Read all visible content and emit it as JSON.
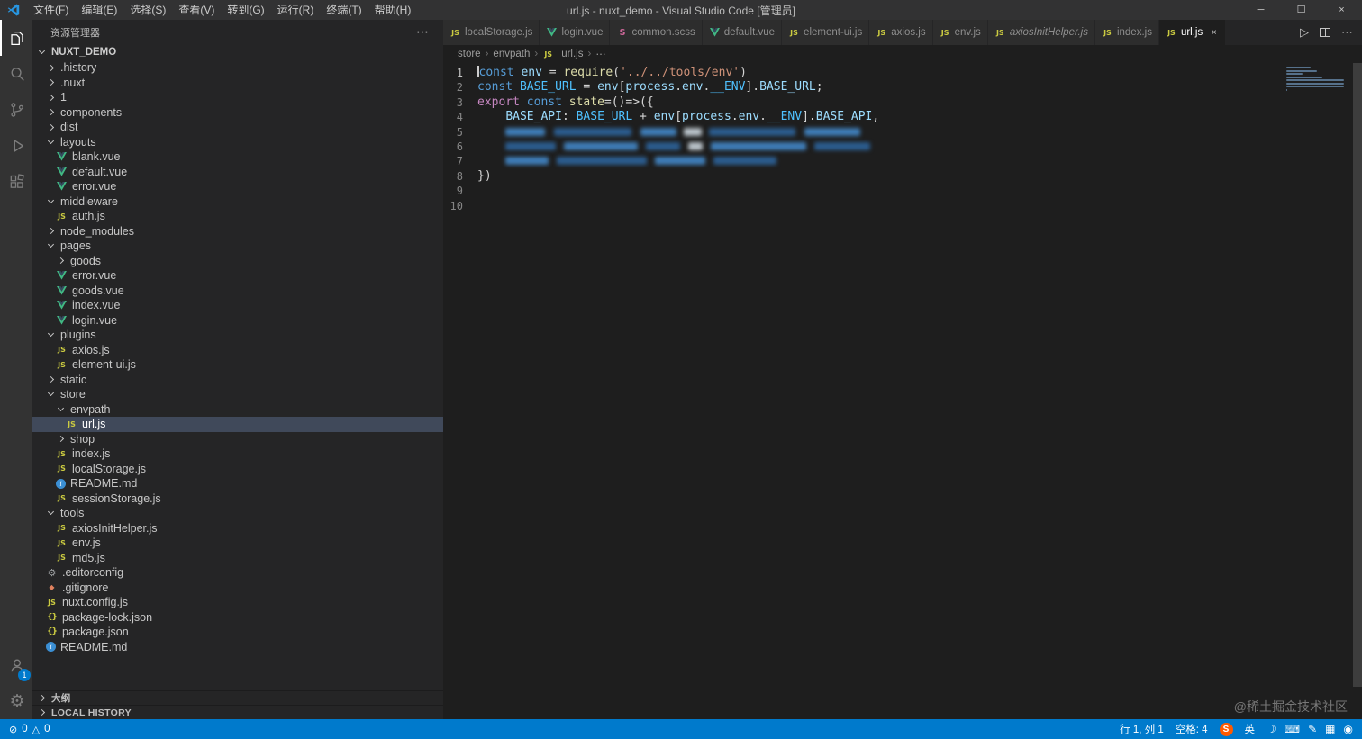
{
  "colors": {
    "accent": "#007acc",
    "statusbar_bg": "#007acc",
    "vue_green": "#41b883",
    "js_yellow": "#cbcb41",
    "scss_pink": "#cd6799",
    "selection_bg": "#40495a"
  },
  "titlebar": {
    "menus": [
      "文件(F)",
      "编辑(E)",
      "选择(S)",
      "查看(V)",
      "转到(G)",
      "运行(R)",
      "终端(T)",
      "帮助(H)"
    ],
    "title": "url.js - nuxt_demo - Visual Studio Code [管理员]",
    "window_controls": {
      "minimize": "─",
      "maximize": "☐",
      "close": "×"
    }
  },
  "activitybar": {
    "top": [
      {
        "name": "explorer",
        "active": true
      },
      {
        "name": "search"
      },
      {
        "name": "source-control"
      },
      {
        "name": "run-debug"
      },
      {
        "name": "extensions"
      }
    ],
    "bottom": [
      {
        "name": "account",
        "badge": "1"
      },
      {
        "name": "settings"
      }
    ]
  },
  "sidebar": {
    "header": "资源管理器",
    "more_actions": "⋯",
    "root": "NUXT_DEMO",
    "tree": [
      {
        "label": ".history",
        "level": 1,
        "kind": "folder",
        "state": "collapsed"
      },
      {
        "label": ".nuxt",
        "level": 1,
        "kind": "folder",
        "state": "collapsed"
      },
      {
        "label": "1",
        "level": 1,
        "kind": "folder",
        "state": "collapsed"
      },
      {
        "label": "components",
        "level": 1,
        "kind": "folder",
        "state": "collapsed"
      },
      {
        "label": "dist",
        "level": 1,
        "kind": "folder",
        "state": "collapsed"
      },
      {
        "label": "layouts",
        "level": 1,
        "kind": "folder",
        "state": "expanded"
      },
      {
        "label": "blank.vue",
        "level": 2,
        "kind": "file",
        "icon": "vue"
      },
      {
        "label": "default.vue",
        "level": 2,
        "kind": "file",
        "icon": "vue"
      },
      {
        "label": "error.vue",
        "level": 2,
        "kind": "file",
        "icon": "vue"
      },
      {
        "label": "middleware",
        "level": 1,
        "kind": "folder",
        "state": "expanded"
      },
      {
        "label": "auth.js",
        "level": 2,
        "kind": "file",
        "icon": "js"
      },
      {
        "label": "node_modules",
        "level": 1,
        "kind": "folder",
        "state": "collapsed"
      },
      {
        "label": "pages",
        "level": 1,
        "kind": "folder",
        "state": "expanded"
      },
      {
        "label": "goods",
        "level": 2,
        "kind": "folder",
        "state": "collapsed"
      },
      {
        "label": "error.vue",
        "level": 2,
        "kind": "file",
        "icon": "vue"
      },
      {
        "label": "goods.vue",
        "level": 2,
        "kind": "file",
        "icon": "vue"
      },
      {
        "label": "index.vue",
        "level": 2,
        "kind": "file",
        "icon": "vue"
      },
      {
        "label": "login.vue",
        "level": 2,
        "kind": "file",
        "icon": "vue"
      },
      {
        "label": "plugins",
        "level": 1,
        "kind": "folder",
        "state": "expanded"
      },
      {
        "label": "axios.js",
        "level": 2,
        "kind": "file",
        "icon": "js"
      },
      {
        "label": "element-ui.js",
        "level": 2,
        "kind": "file",
        "icon": "js"
      },
      {
        "label": "static",
        "level": 1,
        "kind": "folder",
        "state": "collapsed"
      },
      {
        "label": "store",
        "level": 1,
        "kind": "folder",
        "state": "expanded"
      },
      {
        "label": "envpath",
        "level": 2,
        "kind": "folder",
        "state": "expanded"
      },
      {
        "label": "url.js",
        "level": 3,
        "kind": "file",
        "icon": "js",
        "selected": true
      },
      {
        "label": "shop",
        "level": 2,
        "kind": "folder",
        "state": "collapsed"
      },
      {
        "label": "index.js",
        "level": 2,
        "kind": "file",
        "icon": "js"
      },
      {
        "label": "localStorage.js",
        "level": 2,
        "kind": "file",
        "icon": "js"
      },
      {
        "label": "README.md",
        "level": 2,
        "kind": "file",
        "icon": "info"
      },
      {
        "label": "sessionStorage.js",
        "level": 2,
        "kind": "file",
        "icon": "js"
      },
      {
        "label": "tools",
        "level": 1,
        "kind": "folder",
        "state": "expanded"
      },
      {
        "label": "axiosInitHelper.js",
        "level": 2,
        "kind": "file",
        "icon": "js"
      },
      {
        "label": "env.js",
        "level": 2,
        "kind": "file",
        "icon": "js"
      },
      {
        "label": "md5.js",
        "level": 2,
        "kind": "file",
        "icon": "js"
      },
      {
        "label": ".editorconfig",
        "level": 1,
        "kind": "file",
        "icon": "gear"
      },
      {
        "label": ".gitignore",
        "level": 1,
        "kind": "file",
        "icon": "git"
      },
      {
        "label": "nuxt.config.js",
        "level": 1,
        "kind": "file",
        "icon": "js"
      },
      {
        "label": "package-lock.json",
        "level": 1,
        "kind": "file",
        "icon": "braces"
      },
      {
        "label": "package.json",
        "level": 1,
        "kind": "file",
        "icon": "braces"
      },
      {
        "label": "README.md",
        "level": 1,
        "kind": "file",
        "icon": "info"
      }
    ],
    "bottom_sections": [
      "大纲",
      "LOCAL HISTORY"
    ]
  },
  "editor": {
    "tabs": [
      {
        "label": "localStorage.js",
        "icon": "js"
      },
      {
        "label": "login.vue",
        "icon": "vue"
      },
      {
        "label": "common.scss",
        "icon": "scss"
      },
      {
        "label": "default.vue",
        "icon": "vue"
      },
      {
        "label": "element-ui.js",
        "icon": "js"
      },
      {
        "label": "axios.js",
        "icon": "js"
      },
      {
        "label": "env.js",
        "icon": "js"
      },
      {
        "label": "axiosInitHelper.js",
        "icon": "js",
        "preview": true
      },
      {
        "label": "index.js",
        "icon": "js"
      },
      {
        "label": "url.js",
        "icon": "js",
        "active": true
      }
    ],
    "actions": {
      "run": "▷",
      "more": "⋯"
    },
    "breadcrumb": [
      {
        "label": "store"
      },
      {
        "label": "envpath"
      },
      {
        "label": "url.js",
        "icon": "js"
      },
      {
        "label": "⋯"
      }
    ],
    "code": {
      "active_line": 1,
      "token_colors": {
        "k": "#569cd6",
        "v": "#9cdcfe",
        "c": "#4fc1ff",
        "f": "#dcdcaa",
        "s": "#ce9178",
        "p": "#d4d4d4",
        "e": "#c586c0"
      },
      "lines": [
        {
          "n": 1,
          "cursor": true,
          "tokens": [
            {
              "t": "const",
              "c": "k"
            },
            {
              "t": " ",
              "c": "p"
            },
            {
              "t": "env",
              "c": "v"
            },
            {
              "t": " = ",
              "c": "p"
            },
            {
              "t": "require",
              "c": "f"
            },
            {
              "t": "(",
              "c": "p"
            },
            {
              "t": "'../../tools/env'",
              "c": "s"
            },
            {
              "t": ")",
              "c": "p"
            }
          ]
        },
        {
          "n": 2,
          "tokens": [
            {
              "t": "const",
              "c": "k"
            },
            {
              "t": " ",
              "c": "p"
            },
            {
              "t": "BASE_URL",
              "c": "c"
            },
            {
              "t": " = ",
              "c": "p"
            },
            {
              "t": "env",
              "c": "v"
            },
            {
              "t": "[",
              "c": "p"
            },
            {
              "t": "process",
              "c": "v"
            },
            {
              "t": ".",
              "c": "p"
            },
            {
              "t": "env",
              "c": "v"
            },
            {
              "t": ".",
              "c": "p"
            },
            {
              "t": "__ENV",
              "c": "c"
            },
            {
              "t": "].",
              "c": "p"
            },
            {
              "t": "BASE_URL",
              "c": "v"
            },
            {
              "t": ";",
              "c": "p"
            }
          ]
        },
        {
          "n": 3,
          "tokens": [
            {
              "t": "export",
              "c": "e"
            },
            {
              "t": " ",
              "c": "p"
            },
            {
              "t": "const",
              "c": "k"
            },
            {
              "t": " ",
              "c": "p"
            },
            {
              "t": "state",
              "c": "f"
            },
            {
              "t": "=()=>({",
              "c": "p"
            }
          ]
        },
        {
          "n": 4,
          "tokens": [
            {
              "t": "    ",
              "c": "p"
            },
            {
              "t": "BASE_API",
              "c": "v"
            },
            {
              "t": ": ",
              "c": "p"
            },
            {
              "t": "BASE_URL",
              "c": "c"
            },
            {
              "t": " + ",
              "c": "p"
            },
            {
              "t": "env",
              "c": "v"
            },
            {
              "t": "[",
              "c": "p"
            },
            {
              "t": "process",
              "c": "v"
            },
            {
              "t": ".",
              "c": "p"
            },
            {
              "t": "env",
              "c": "v"
            },
            {
              "t": ".",
              "c": "p"
            },
            {
              "t": "__ENV",
              "c": "c"
            },
            {
              "t": "].",
              "c": "p"
            },
            {
              "t": "BASE_API",
              "c": "v"
            },
            {
              "t": ",",
              "c": "p"
            }
          ]
        },
        {
          "n": 5,
          "tokens": [
            {
              "t": "    ",
              "c": "p"
            },
            {
              "b": 44,
              "col": "#3e7cb6"
            },
            {
              "g": 10
            },
            {
              "b": 86,
              "col": "#2b5c8e"
            },
            {
              "g": 10
            },
            {
              "b": 40,
              "col": "#3e7cb6"
            },
            {
              "g": 8
            },
            {
              "b": 20,
              "col": "#b9c2c9"
            },
            {
              "g": 8
            },
            {
              "b": 96,
              "col": "#2b5c8e"
            },
            {
              "g": 10
            },
            {
              "b": 62,
              "col": "#3e7cb6"
            }
          ]
        },
        {
          "n": 6,
          "tokens": [
            {
              "t": "    ",
              "c": "p"
            },
            {
              "b": 56,
              "col": "#2b5c8e"
            },
            {
              "g": 9
            },
            {
              "b": 82,
              "col": "#3e7cb6"
            },
            {
              "g": 9
            },
            {
              "b": 38,
              "col": "#2b5c8e"
            },
            {
              "g": 9
            },
            {
              "b": 16,
              "col": "#b9c2c9"
            },
            {
              "g": 9
            },
            {
              "b": 106,
              "col": "#3e7cb6"
            },
            {
              "g": 9
            },
            {
              "b": 62,
              "col": "#2b5c8e"
            }
          ]
        },
        {
          "n": 7,
          "tokens": [
            {
              "t": "    ",
              "c": "p"
            },
            {
              "b": 48,
              "col": "#3e7cb6"
            },
            {
              "g": 9
            },
            {
              "b": 100,
              "col": "#2b5c8e"
            },
            {
              "g": 9
            },
            {
              "b": 56,
              "col": "#3e7cb6"
            },
            {
              "g": 9
            },
            {
              "b": 70,
              "col": "#2b5c8e"
            }
          ]
        },
        {
          "n": 8,
          "tokens": [
            {
              "t": "})",
              "c": "p"
            }
          ]
        },
        {
          "n": 9,
          "tokens": []
        },
        {
          "n": 10,
          "tokens": []
        }
      ]
    }
  },
  "statusbar": {
    "errors": "0",
    "warnings": "0",
    "line_col": "行 1, 列 1",
    "spaces": "空格: 4",
    "ime": {
      "logo": "S",
      "mode": "英",
      "icons": [
        {
          "name": "moon-icon",
          "glyph": "☽"
        },
        {
          "name": "keyboard-icon",
          "glyph": "⌨"
        },
        {
          "name": "pen-icon",
          "glyph": "✎"
        },
        {
          "name": "grid-icon",
          "glyph": "▦"
        },
        {
          "name": "mic-icon",
          "glyph": "◉"
        }
      ]
    }
  },
  "watermark": "@稀土掘金技术社区"
}
